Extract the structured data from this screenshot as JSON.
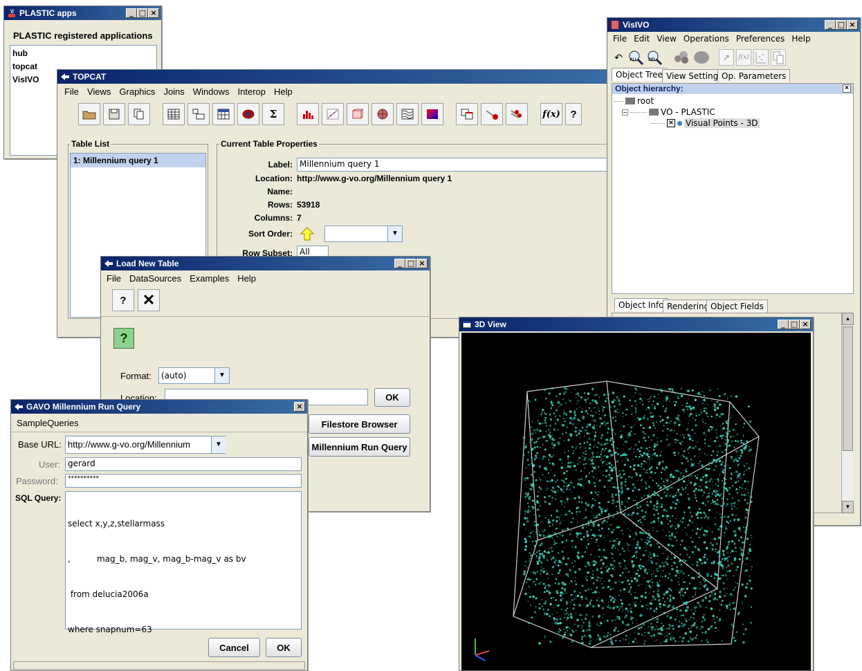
{
  "plastic": {
    "title": "PLASTIC apps",
    "heading": "PLASTIC registered applications",
    "apps": [
      "hub",
      "topcat",
      "VisIVO"
    ]
  },
  "topcat": {
    "title": "TOPCAT",
    "menu": [
      "File",
      "Views",
      "Graphics",
      "Joins",
      "Windows",
      "Interop",
      "Help"
    ],
    "table_list_title": "Table List",
    "table_list_item": "1: Millennium query 1",
    "props_title": "Current Table Properties",
    "label_label": "Label:",
    "label_value": "Millennium query 1",
    "location_label": "Location:",
    "location_value": "http://www.g-vo.org/Millennium query 1",
    "name_label": "Name:",
    "rows_label": "Rows:",
    "rows_value": "53918",
    "columns_label": "Columns:",
    "columns_value": "7",
    "sort_label": "Sort Order:",
    "subset_label": "Row Subset:",
    "subset_value": "All",
    "sigma_label": "Σ",
    "func_label": "f(x)"
  },
  "load": {
    "title": "Load New Table",
    "menu": [
      "File",
      "DataSources",
      "Examples",
      "Help"
    ],
    "format_label": "Format:",
    "format_value": "(auto)",
    "location_label": "Location:",
    "ok_label": "OK",
    "filestore_label": "Filestore Browser",
    "millennium_label": "Millennium Run Query"
  },
  "gavo": {
    "title": "GAVO Millennium Run Query",
    "sample_queries": "SampleQueries",
    "base_url_label": "Base URL:",
    "base_url_value": "http://www.g-vo.org/Millennium",
    "user_label": "User:",
    "user_value": "gerard",
    "password_label": "Password:",
    "password_value": "**********",
    "sql_label": "SQL Query:",
    "sql_lines": [
      "select x,y,z,stellarmass",
      ",          mag_b, mag_v, mag_b-mag_v as bv",
      " from delucia2006a",
      "where snapnum=63"
    ],
    "cancel_label": "Cancel",
    "ok_label": "OK"
  },
  "visivo": {
    "title": "VisIVO",
    "menu": [
      "File",
      "Edit",
      "View",
      "Operations",
      "Preferences",
      "Help"
    ],
    "tabs": [
      "Object Tree",
      "View Settings",
      "Op. Parameters"
    ],
    "hierarchy_label": "Object hierarchy:",
    "root_label": "root",
    "vo_label": "VO - PLASTIC",
    "points_label": "Visual Points - 3D",
    "tool_all": "ALL",
    "tool_sel": "SEL",
    "tool_fx": "f(x)",
    "bottom_tabs": [
      "Object Info",
      "Rendering",
      "Object Fields"
    ]
  },
  "view3d": {
    "title": "3D View",
    "point_color": "#3fd3bf"
  },
  "colors": {
    "title_start": "#0a246a",
    "title_end": "#3a6ea5",
    "window_bg": "#ece9d8",
    "selection": "#c1d2ee"
  }
}
